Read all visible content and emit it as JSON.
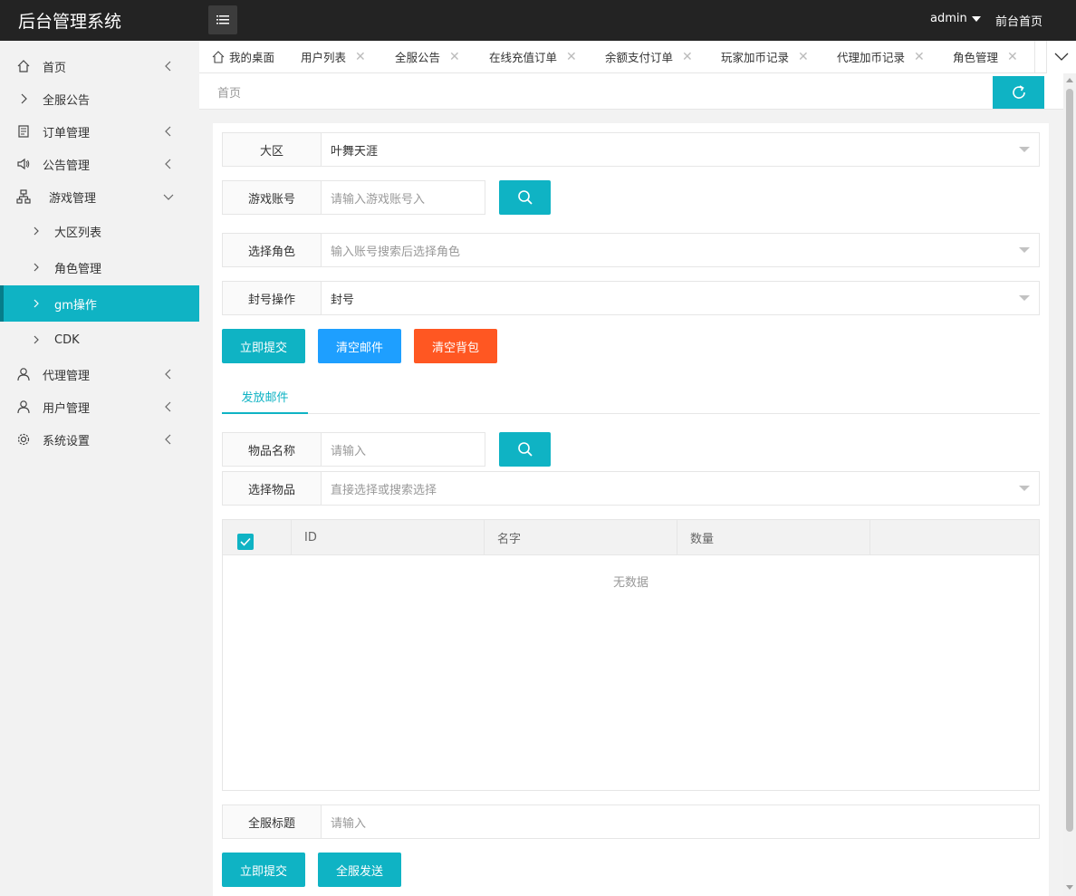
{
  "app": {
    "title": "后台管理系统"
  },
  "header": {
    "user": "admin",
    "front_link": "前台首页"
  },
  "sidebar": {
    "items": [
      {
        "label": "首页"
      },
      {
        "label": "全服公告"
      },
      {
        "label": "订单管理"
      },
      {
        "label": "公告管理"
      },
      {
        "label": "游戏管理"
      },
      {
        "label": "代理管理"
      },
      {
        "label": "用户管理"
      },
      {
        "label": "系统设置"
      }
    ],
    "sub_items": [
      {
        "label": "大区列表"
      },
      {
        "label": "角色管理"
      },
      {
        "label": "gm操作"
      },
      {
        "label": "CDK"
      }
    ]
  },
  "tabs": [
    {
      "label": "我的桌面"
    },
    {
      "label": "用户列表"
    },
    {
      "label": "全服公告"
    },
    {
      "label": "在线充值订单"
    },
    {
      "label": "余额支付订单"
    },
    {
      "label": "玩家加币记录"
    },
    {
      "label": "代理加币记录"
    },
    {
      "label": "角色管理"
    }
  ],
  "breadcrumb": "首页",
  "form": {
    "region": {
      "label": "大区",
      "value": "叶舞天涯"
    },
    "account": {
      "label": "游戏账号",
      "placeholder": "请输入游戏账号入"
    },
    "role": {
      "label": "选择角色",
      "placeholder": "输入账号搜索后选择角色"
    },
    "ban": {
      "label": "封号操作",
      "value": "封号"
    }
  },
  "buttons": {
    "submit": "立即提交",
    "clear_mail": "清空邮件",
    "clear_bag": "清空背包",
    "submit2": "立即提交",
    "broadcast": "全服发送"
  },
  "mail_tab": "发放邮件",
  "item_form": {
    "name": {
      "label": "物品名称",
      "placeholder": "请输入"
    },
    "select": {
      "label": "选择物品",
      "placeholder": "直接选择或搜索选择"
    }
  },
  "table": {
    "columns": [
      "ID",
      "名字",
      "数量"
    ],
    "empty": "无数据"
  },
  "broadcast_title": {
    "label": "全服标题",
    "placeholder": "请输入"
  },
  "colors": {
    "accent": "#0fb3c4",
    "blue": "#1e9fff",
    "red": "#ff5722",
    "header": "#232323"
  }
}
